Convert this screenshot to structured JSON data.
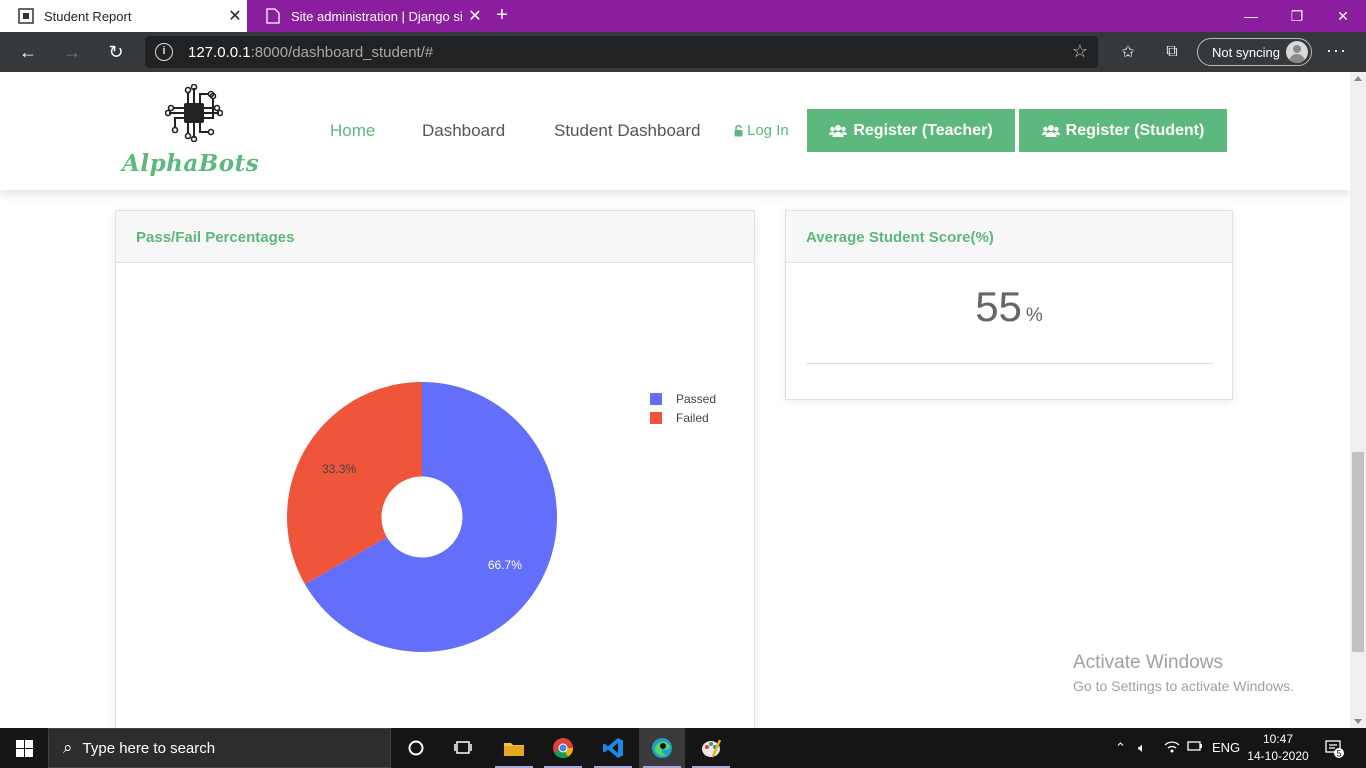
{
  "browser": {
    "tabs": [
      {
        "title": "Student Report",
        "active": true
      },
      {
        "title": "Site administration | Django site",
        "active": false
      }
    ],
    "url_host": "127.0.0.1",
    "url_rest": ":8000/dashboard_student/#",
    "sync_label": "Not syncing",
    "colors": {
      "titlebar": "#8a1e9e",
      "toolbar": "#36393b"
    }
  },
  "site": {
    "brand": "AlphaBots",
    "nav": [
      "Home",
      "Dashboard",
      "Student Dashboard"
    ],
    "login": "Log In",
    "register_teacher": "Register (Teacher)",
    "register_student": "Register (Student)",
    "accent": "#5cb87c"
  },
  "cards": {
    "passfail_title": "Pass/Fail Percentages",
    "avg_title": "Average Student Score(%)",
    "avg_value": "55",
    "avg_unit": "%"
  },
  "chart_data": {
    "type": "pie",
    "hole": 0.3,
    "categories": [
      "Passed",
      "Failed"
    ],
    "values": [
      66.7,
      33.3
    ],
    "labels": [
      "66.7%",
      "33.3%"
    ],
    "colors": [
      "#636efa",
      "#ef553b"
    ],
    "legend": "top-right"
  },
  "watermark": {
    "line1": "Activate Windows",
    "line2": "Go to Settings to activate Windows."
  },
  "taskbar": {
    "search_placeholder": "Type here to search",
    "lang": "ENG",
    "time": "10:47",
    "date": "14-10-2020",
    "notifications": "5"
  }
}
